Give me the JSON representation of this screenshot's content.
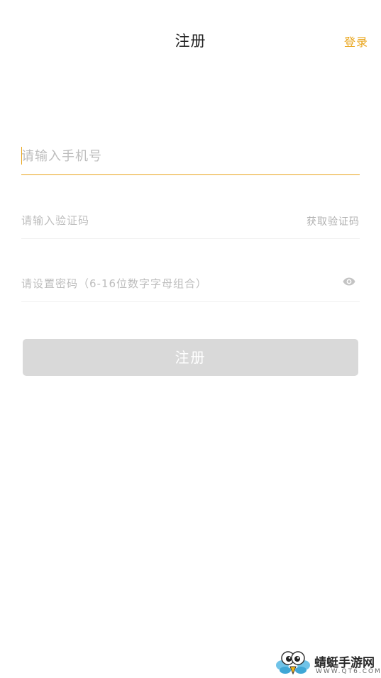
{
  "header": {
    "title": "注册",
    "login_label": "登录"
  },
  "form": {
    "phone_placeholder": "请输入手机号",
    "code_placeholder": "请输入验证码",
    "get_code_label": "获取验证码",
    "password_placeholder": "请设置密码（6-16位数字字母组合）",
    "password_toggle_icon": "eye-icon",
    "submit_label": "注册"
  },
  "colors": {
    "accent": "#e9a51c",
    "button_disabled_bg": "#d9d9d9",
    "placeholder": "#bdbdbd"
  },
  "watermark": {
    "name": "蜻蜓手游网",
    "url": "WWW.QT6.COM"
  }
}
